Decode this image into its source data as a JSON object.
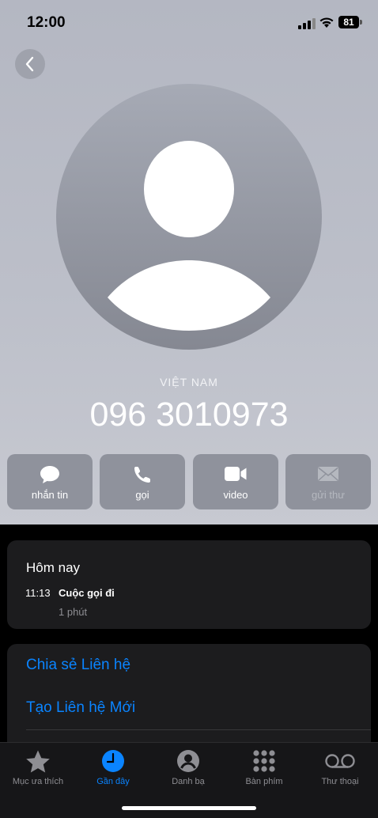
{
  "status": {
    "time": "12:00",
    "battery": "81"
  },
  "contact": {
    "country": "VIỆT NAM",
    "number": "096 3010973"
  },
  "actions": [
    {
      "label": "nhắn tin",
      "icon": "message-icon",
      "enabled": true
    },
    {
      "label": "gọi",
      "icon": "phone-icon",
      "enabled": true
    },
    {
      "label": "video",
      "icon": "video-icon",
      "enabled": true
    },
    {
      "label": "gửi thư",
      "icon": "mail-icon",
      "enabled": false
    }
  ],
  "history": {
    "heading": "Hôm nay",
    "time": "11:13",
    "type": "Cuộc gọi đi",
    "duration": "1 phút"
  },
  "links": [
    "Chia sẻ Liên hệ",
    "Tạo Liên hệ Mới"
  ],
  "tabs": [
    {
      "label": "Mục ưa thích",
      "icon": "star-icon",
      "active": false
    },
    {
      "label": "Gần đây",
      "icon": "clock-icon",
      "active": true
    },
    {
      "label": "Danh bạ",
      "icon": "person-icon",
      "active": false
    },
    {
      "label": "Bàn phím",
      "icon": "keypad-icon",
      "active": false
    },
    {
      "label": "Thư thoại",
      "icon": "voicemail-icon",
      "active": false
    }
  ],
  "colors": {
    "accent": "#0a84ff",
    "card": "#1c1c1e",
    "action_button": "#8f929c"
  }
}
